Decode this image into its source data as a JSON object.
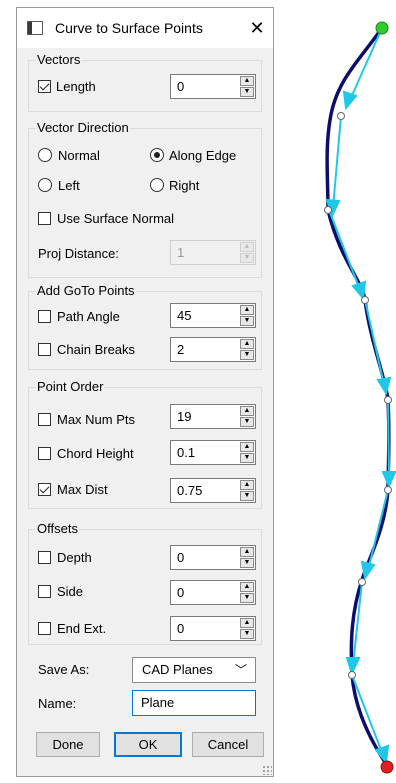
{
  "dialog": {
    "title": "Curve to Surface Points",
    "close_glyph": "✕",
    "vectors": {
      "label": "Vectors",
      "length": {
        "label": "Length",
        "checked": true,
        "value": "0"
      }
    },
    "vector_direction": {
      "label": "Vector Direction",
      "normal": {
        "label": "Normal",
        "selected": false
      },
      "along_edge": {
        "label": "Along Edge",
        "selected": true
      },
      "left": {
        "label": "Left",
        "selected": false
      },
      "right": {
        "label": "Right",
        "selected": false
      },
      "use_surface_normal": {
        "label": "Use Surface Normal",
        "checked": false
      },
      "proj_distance": {
        "label": "Proj Distance:",
        "value": "1",
        "enabled": false
      }
    },
    "add_goto_points": {
      "label": "Add GoTo Points",
      "path_angle": {
        "label": "Path Angle",
        "checked": false,
        "value": "45"
      },
      "chain_breaks": {
        "label": "Chain Breaks",
        "checked": false,
        "value": "2"
      }
    },
    "point_order": {
      "label": "Point Order",
      "max_num_pts": {
        "label": "Max Num Pts",
        "checked": false,
        "value": "19"
      },
      "chord_height": {
        "label": "Chord Height",
        "checked": false,
        "value": "0.1"
      },
      "max_dist": {
        "label": "Max Dist",
        "checked": true,
        "value": "0.75"
      }
    },
    "offsets": {
      "label": "Offsets",
      "depth": {
        "label": "Depth",
        "checked": false,
        "value": "0"
      },
      "side": {
        "label": "Side",
        "checked": false,
        "value": "0"
      },
      "end_ext": {
        "label": "End Ext.",
        "checked": false,
        "value": "0"
      }
    },
    "save_as": {
      "label": "Save As:",
      "value": "CAD Planes"
    },
    "name": {
      "label": "Name:",
      "value": "Plane"
    },
    "buttons": {
      "done": "Done",
      "ok": "OK",
      "cancel": "Cancel"
    }
  },
  "colors": {
    "curve": "#0d0d6e",
    "vectors": "#1ec8e6",
    "start_point": "#2ecc2e",
    "end_point": "#e02020"
  },
  "icons": [
    "app-icon",
    "close-icon",
    "spin-up-icon",
    "spin-down-icon",
    "chevron-down-icon",
    "resize-grip-icon"
  ]
}
